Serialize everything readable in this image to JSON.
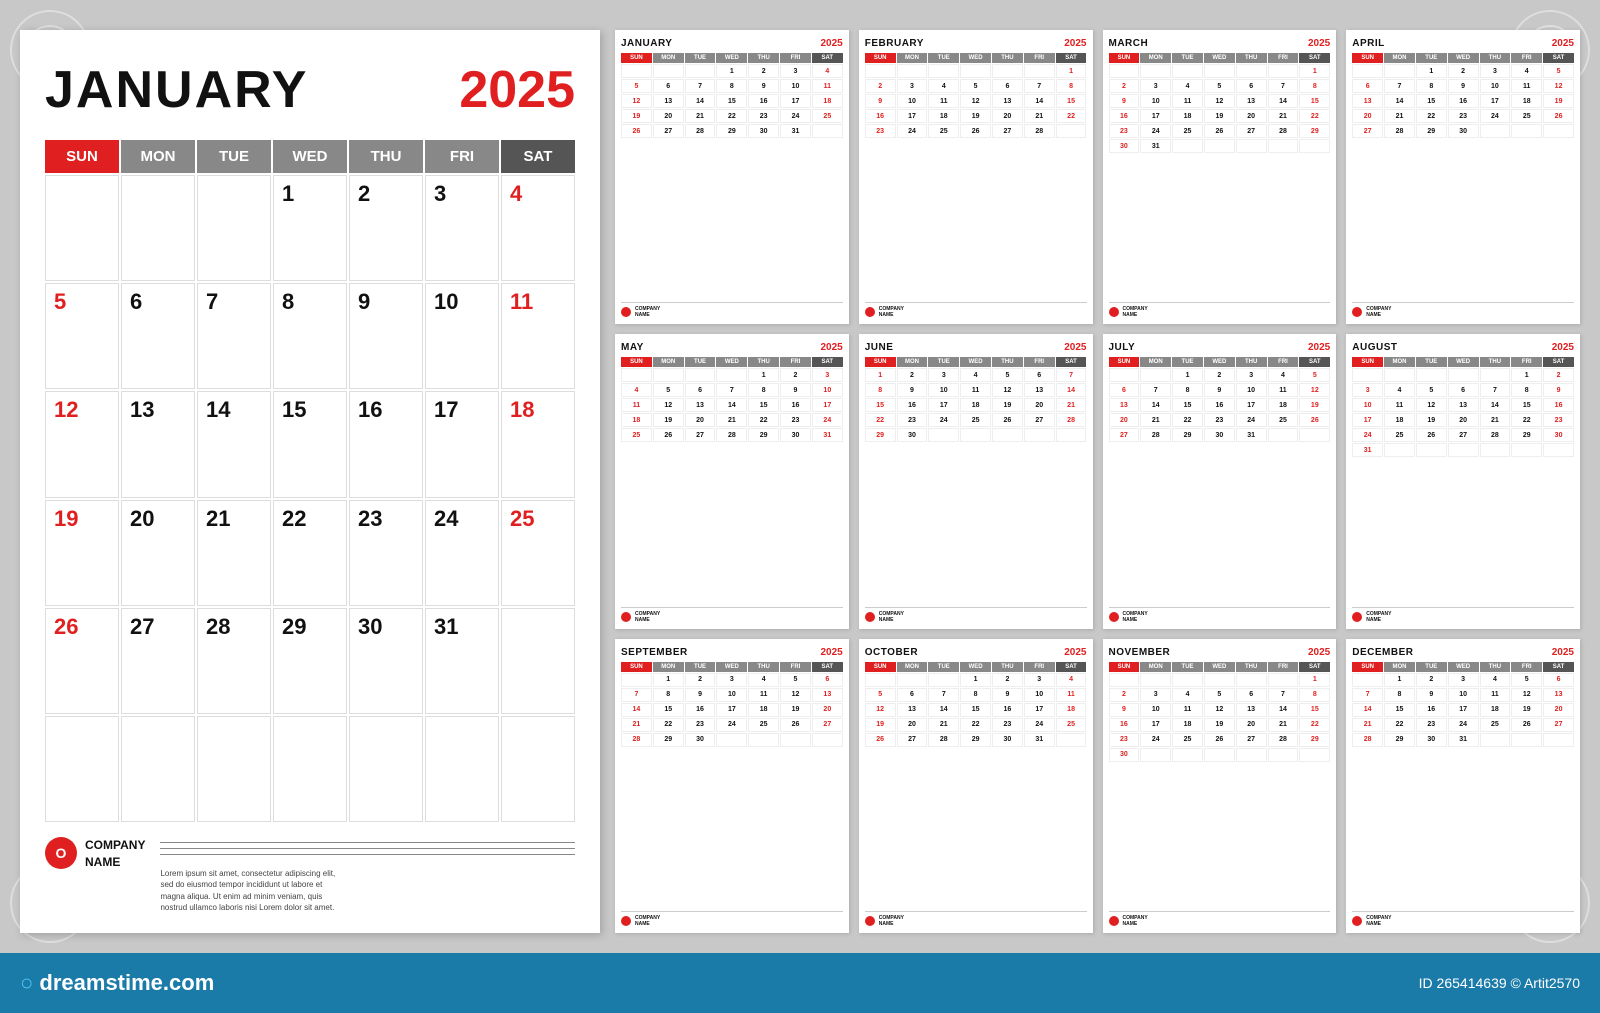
{
  "app": {
    "background": "#c8c8c8"
  },
  "dreamstime": {
    "logo": "dreamstime.com",
    "id": "ID 265414639",
    "copyright": "© Artit2570"
  },
  "large_calendar": {
    "month": "JANUARY",
    "year": "2025",
    "days_header": [
      "SUN",
      "MON",
      "TUE",
      "WED",
      "THU",
      "FRI",
      "SAT"
    ],
    "weeks": [
      [
        "",
        "",
        "",
        "1",
        "2",
        "3",
        "4"
      ],
      [
        "5",
        "6",
        "7",
        "8",
        "9",
        "10",
        "11"
      ],
      [
        "12",
        "13",
        "14",
        "15",
        "16",
        "17",
        "18"
      ],
      [
        "19",
        "20",
        "21",
        "22",
        "23",
        "24",
        "25"
      ],
      [
        "26",
        "27",
        "28",
        "29",
        "30",
        "31",
        ""
      ],
      [
        "",
        "",
        "",
        "",
        "",
        "",
        ""
      ]
    ],
    "company_name": "COMPANY\nNAME",
    "footer_text": "Lorem ipsum sit amet, consectetur adipiscing elit, sed do eiusmod tempor incididunt ut labore et magna aliqua. Ut enim ad minim veniam, quis nostrud ullamco laboris nisi Lorem dolor sit amet."
  },
  "small_calendars": [
    {
      "month": "JANUARY",
      "year": "2025",
      "weeks": [
        [
          "",
          "",
          "",
          "1",
          "2",
          "3",
          "4"
        ],
        [
          "5",
          "6",
          "7",
          "8",
          "9",
          "10",
          "11"
        ],
        [
          "12",
          "13",
          "14",
          "15",
          "16",
          "17",
          "18"
        ],
        [
          "19",
          "20",
          "21",
          "22",
          "23",
          "24",
          "25"
        ],
        [
          "26",
          "27",
          "28",
          "29",
          "30",
          "31",
          ""
        ]
      ]
    },
    {
      "month": "FEBRUARY",
      "year": "2025",
      "weeks": [
        [
          "",
          "",
          "",
          "",
          "",
          "",
          "1"
        ],
        [
          "2",
          "3",
          "4",
          "5",
          "6",
          "7",
          "8"
        ],
        [
          "9",
          "10",
          "11",
          "12",
          "13",
          "14",
          "15"
        ],
        [
          "16",
          "17",
          "18",
          "19",
          "20",
          "21",
          "22"
        ],
        [
          "23",
          "24",
          "25",
          "26",
          "27",
          "28",
          ""
        ]
      ]
    },
    {
      "month": "MARCH",
      "year": "2025",
      "weeks": [
        [
          "",
          "",
          "",
          "",
          "",
          "",
          "1"
        ],
        [
          "2",
          "3",
          "4",
          "5",
          "6",
          "7",
          "8"
        ],
        [
          "9",
          "10",
          "11",
          "12",
          "13",
          "14",
          "15"
        ],
        [
          "16",
          "17",
          "18",
          "19",
          "20",
          "21",
          "22"
        ],
        [
          "23",
          "24",
          "25",
          "26",
          "27",
          "28",
          "29"
        ],
        [
          "30",
          "31",
          "",
          "",
          "",
          "",
          ""
        ]
      ]
    },
    {
      "month": "APRIL",
      "year": "2025",
      "weeks": [
        [
          "",
          "",
          "1",
          "2",
          "3",
          "4",
          "5"
        ],
        [
          "6",
          "7",
          "8",
          "9",
          "10",
          "11",
          "12"
        ],
        [
          "13",
          "14",
          "15",
          "16",
          "17",
          "18",
          "19"
        ],
        [
          "20",
          "21",
          "22",
          "23",
          "24",
          "25",
          "26"
        ],
        [
          "27",
          "28",
          "29",
          "30",
          "",
          "",
          ""
        ]
      ]
    },
    {
      "month": "MAY",
      "year": "2025",
      "weeks": [
        [
          "",
          "",
          "",
          "",
          "1",
          "2",
          "3"
        ],
        [
          "4",
          "5",
          "6",
          "7",
          "8",
          "9",
          "10"
        ],
        [
          "11",
          "12",
          "13",
          "14",
          "15",
          "16",
          "17"
        ],
        [
          "18",
          "19",
          "20",
          "21",
          "22",
          "23",
          "24"
        ],
        [
          "25",
          "26",
          "27",
          "28",
          "29",
          "30",
          "31"
        ]
      ]
    },
    {
      "month": "JUNE",
      "year": "2025",
      "weeks": [
        [
          "1",
          "2",
          "3",
          "4",
          "5",
          "6",
          "7"
        ],
        [
          "8",
          "9",
          "10",
          "11",
          "12",
          "13",
          "14"
        ],
        [
          "15",
          "16",
          "17",
          "18",
          "19",
          "20",
          "21"
        ],
        [
          "22",
          "23",
          "24",
          "25",
          "26",
          "27",
          "28"
        ],
        [
          "29",
          "30",
          "",
          "",
          "",
          "",
          ""
        ]
      ]
    },
    {
      "month": "JULY",
      "year": "2025",
      "weeks": [
        [
          "",
          "",
          "1",
          "2",
          "3",
          "4",
          "5"
        ],
        [
          "6",
          "7",
          "8",
          "9",
          "10",
          "11",
          "12"
        ],
        [
          "13",
          "14",
          "15",
          "16",
          "17",
          "18",
          "19"
        ],
        [
          "20",
          "21",
          "22",
          "23",
          "24",
          "25",
          "26"
        ],
        [
          "27",
          "28",
          "29",
          "30",
          "31",
          "",
          ""
        ]
      ]
    },
    {
      "month": "AUGUST",
      "year": "2025",
      "weeks": [
        [
          "",
          "",
          "",
          "",
          "",
          "1",
          "2"
        ],
        [
          "3",
          "4",
          "5",
          "6",
          "7",
          "8",
          "9"
        ],
        [
          "10",
          "11",
          "12",
          "13",
          "14",
          "15",
          "16"
        ],
        [
          "17",
          "18",
          "19",
          "20",
          "21",
          "22",
          "23"
        ],
        [
          "24",
          "25",
          "26",
          "27",
          "28",
          "29",
          "30"
        ],
        [
          "31",
          "",
          "",
          "",
          "",
          "",
          ""
        ]
      ]
    },
    {
      "month": "SEPTEMBER",
      "year": "2025",
      "weeks": [
        [
          "",
          "1",
          "2",
          "3",
          "4",
          "5",
          "6"
        ],
        [
          "7",
          "8",
          "9",
          "10",
          "11",
          "12",
          "13"
        ],
        [
          "14",
          "15",
          "16",
          "17",
          "18",
          "19",
          "20"
        ],
        [
          "21",
          "22",
          "23",
          "24",
          "25",
          "26",
          "27"
        ],
        [
          "28",
          "29",
          "30",
          "",
          "",
          "",
          ""
        ]
      ]
    },
    {
      "month": "OCTOBER",
      "year": "2025",
      "weeks": [
        [
          "",
          "",
          "",
          "1",
          "2",
          "3",
          "4"
        ],
        [
          "5",
          "6",
          "7",
          "8",
          "9",
          "10",
          "11"
        ],
        [
          "12",
          "13",
          "14",
          "15",
          "16",
          "17",
          "18"
        ],
        [
          "19",
          "20",
          "21",
          "22",
          "23",
          "24",
          "25"
        ],
        [
          "26",
          "27",
          "28",
          "29",
          "30",
          "31",
          ""
        ]
      ]
    },
    {
      "month": "NOVEMBER",
      "year": "2025",
      "weeks": [
        [
          "",
          "",
          "",
          "",
          "",
          "",
          "1"
        ],
        [
          "2",
          "3",
          "4",
          "5",
          "6",
          "7",
          "8"
        ],
        [
          "9",
          "10",
          "11",
          "12",
          "13",
          "14",
          "15"
        ],
        [
          "16",
          "17",
          "18",
          "19",
          "20",
          "21",
          "22"
        ],
        [
          "23",
          "24",
          "25",
          "26",
          "27",
          "28",
          "29"
        ],
        [
          "30",
          "",
          "",
          "",
          "",
          "",
          ""
        ]
      ]
    },
    {
      "month": "DECEMBER",
      "year": "2025",
      "weeks": [
        [
          "",
          "1",
          "2",
          "3",
          "4",
          "5",
          "6"
        ],
        [
          "7",
          "8",
          "9",
          "10",
          "11",
          "12",
          "13"
        ],
        [
          "14",
          "15",
          "16",
          "17",
          "18",
          "19",
          "20"
        ],
        [
          "21",
          "22",
          "23",
          "24",
          "25",
          "26",
          "27"
        ],
        [
          "28",
          "29",
          "30",
          "31",
          "",
          "",
          ""
        ]
      ]
    }
  ]
}
